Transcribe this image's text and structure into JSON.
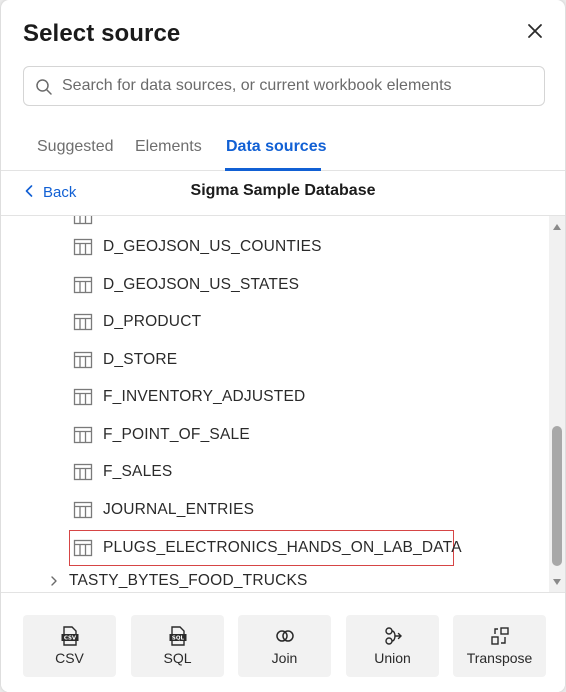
{
  "dialog": {
    "title": "Select source",
    "search_placeholder": "Search for data sources, or current workbook elements"
  },
  "tabs": [
    {
      "label": "Suggested",
      "active": false
    },
    {
      "label": "Elements",
      "active": false
    },
    {
      "label": "Data sources",
      "active": true
    }
  ],
  "nav": {
    "back_label": "Back",
    "database_title": "Sigma Sample Database"
  },
  "list": {
    "items": [
      {
        "label": "D_GEOJSON_US_COUNTIES",
        "icon": "table-icon"
      },
      {
        "label": "D_GEOJSON_US_STATES",
        "icon": "table-icon"
      },
      {
        "label": "D_PRODUCT",
        "icon": "table-icon"
      },
      {
        "label": "D_STORE",
        "icon": "table-icon"
      },
      {
        "label": "F_INVENTORY_ADJUSTED",
        "icon": "table-icon"
      },
      {
        "label": "F_POINT_OF_SALE",
        "icon": "table-icon"
      },
      {
        "label": "F_SALES",
        "icon": "table-icon"
      },
      {
        "label": "JOURNAL_ENTRIES",
        "icon": "table-icon"
      },
      {
        "label": "PLUGS_ELECTRONICS_HANDS_ON_LAB_DATA",
        "icon": "table-icon",
        "highlighted": true
      }
    ],
    "folder": {
      "label": "TASTY_BYTES_FOOD_TRUCKS",
      "icon": "chevron-right-icon"
    }
  },
  "footer": {
    "buttons": [
      {
        "label": "CSV",
        "icon": "csv-file-icon"
      },
      {
        "label": "SQL",
        "icon": "sql-file-icon"
      },
      {
        "label": "Join",
        "icon": "join-icon"
      },
      {
        "label": "Union",
        "icon": "union-icon"
      },
      {
        "label": "Transpose",
        "icon": "transpose-icon"
      }
    ]
  },
  "colors": {
    "accent": "#1160d4",
    "highlight_border": "#d64545",
    "footer_button_bg": "#f2f2f2"
  }
}
